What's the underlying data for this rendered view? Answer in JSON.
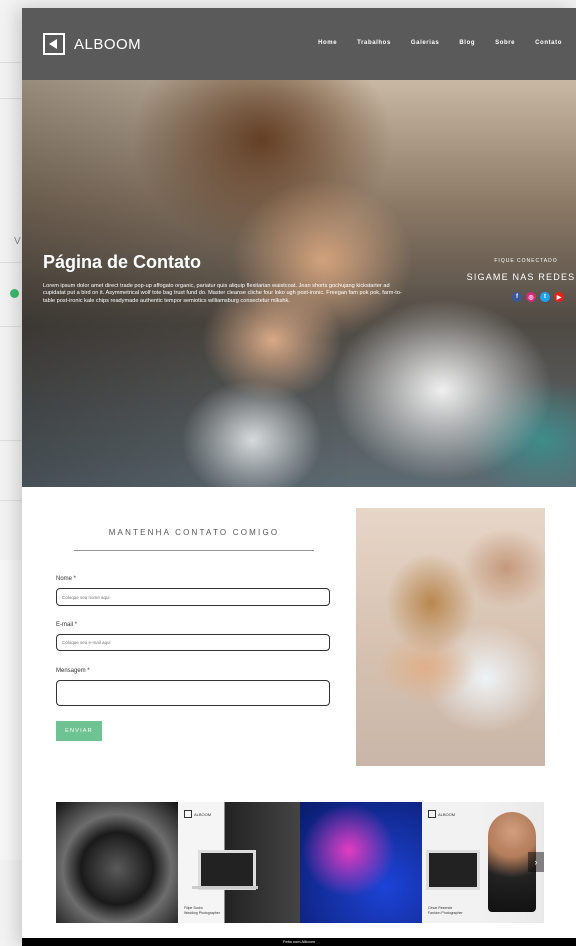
{
  "site": {
    "logo_text": "ALBOOM",
    "nav": [
      "Home",
      "Trabalhos",
      "Galerias",
      "Blog",
      "Sobre",
      "Contato"
    ]
  },
  "hero": {
    "title": "Página de Contato",
    "text": "Lorem ipsum dolor amet direct trade pop-up affogato organic, pariatur quis aliquip flexitarian waistcoat. Jean shorts gochujang kickstarter ad cupidatat put a bird on it. Asymmetrical wolf tote bag trust fund do. Master cleanse cliche four loko ugh post-ironic. Freegan fam pok pok, farm-to-table post-ironic kale chips readymade authentic tempor semiotics williamsburg consectetur mlkshk.",
    "follow_small": "FIQUE CONECTADO",
    "follow_big": "SIGAME NAS REDES",
    "socials": [
      {
        "icon": "facebook-icon",
        "glyph": "f",
        "color": "#3b5998"
      },
      {
        "icon": "instagram-icon",
        "glyph": "◎",
        "color": "#d6297a"
      },
      {
        "icon": "twitter-icon",
        "glyph": "t",
        "color": "#1da1f2"
      },
      {
        "icon": "youtube-icon",
        "glyph": "▶",
        "color": "#e62117"
      }
    ]
  },
  "contact": {
    "title": "MANTENHA CONTATO COMIGO",
    "name_label": "Nome *",
    "name_placeholder": "Coloque seu nome aqui",
    "email_label": "E-mail *",
    "email_placeholder": "Coloque seu e-mail aqui",
    "message_label": "Mensagem *",
    "send_label": "ENVIAR"
  },
  "gallery": {
    "logo_text": "ALBOOM",
    "caption_2a": "Filipe Sodrú",
    "caption_2b": "Wedding Photographer",
    "caption_4a": "César Rezende",
    "caption_4b": "Fashion Photographer"
  },
  "footer": {
    "text": "Feito com Alboom"
  }
}
